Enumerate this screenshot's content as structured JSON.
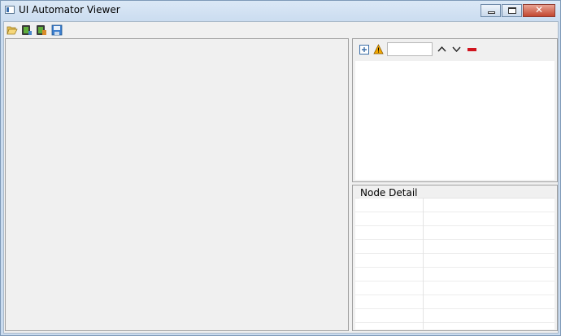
{
  "window": {
    "title": "UI Automator Viewer"
  },
  "title_buttons": {
    "minimize": "minimize-icon",
    "maximize": "maximize-icon",
    "close": "close-icon",
    "close_glyph": "✕"
  },
  "toolbar": {
    "icons": [
      "open-folder-icon",
      "device-screenshot-icon",
      "device-screenshot-compressed-icon",
      "save-icon"
    ]
  },
  "tree_toolbar": {
    "icons": [
      "expand-all-icon",
      "warning-icon",
      "previous-icon",
      "next-icon",
      "clear-icon"
    ],
    "search_value": ""
  },
  "node_detail": {
    "label": "Node Detail",
    "rows": 9
  },
  "colors": {
    "accent_warning": "#f2a700",
    "clear_red": "#d0141e",
    "close_red": "#c2462f"
  }
}
